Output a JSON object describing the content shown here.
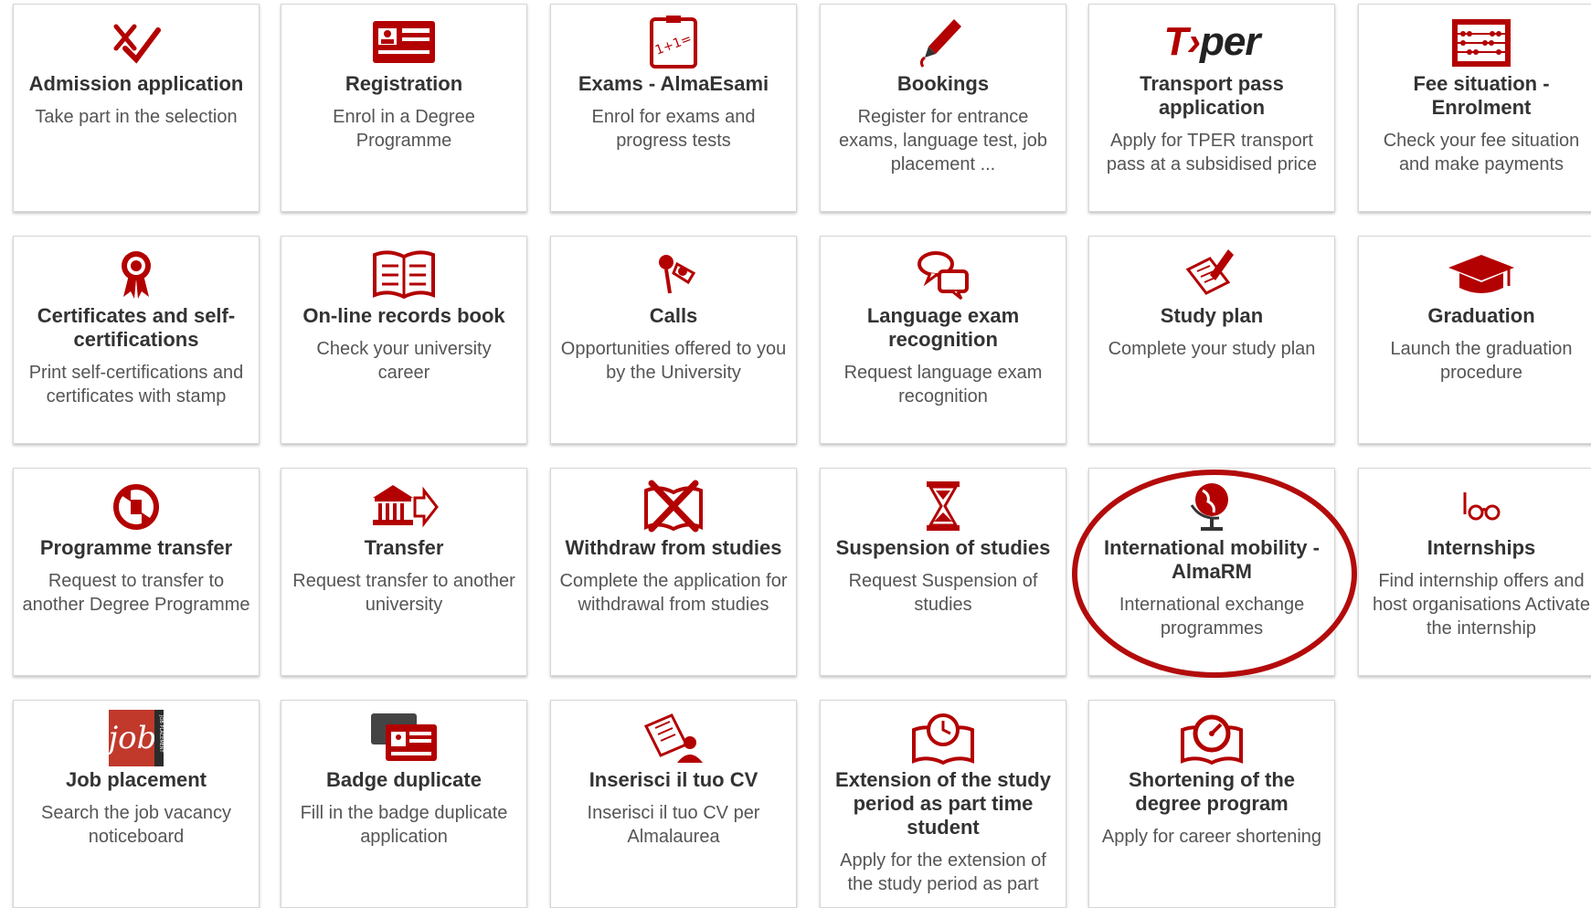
{
  "tiles": [
    {
      "id": "admission",
      "icon": "check-cross-icon",
      "title": "Admission application",
      "desc": "Take part in the selection"
    },
    {
      "id": "registration",
      "icon": "id-card-icon",
      "title": "Registration",
      "desc": "Enrol in a Degree Programme"
    },
    {
      "id": "exams",
      "icon": "calculator-board-icon",
      "title": "Exams - AlmaEsami",
      "desc": "Enrol for exams and progress tests"
    },
    {
      "id": "bookings",
      "icon": "pen-icon",
      "title": "Bookings",
      "desc": "Register for entrance exams, language test, job placement ..."
    },
    {
      "id": "transport",
      "icon": "tper-logo",
      "title": "Transport pass application",
      "desc": "Apply for TPER transport pass at a subsidised price"
    },
    {
      "id": "fee",
      "icon": "abacus-icon",
      "title": "Fee situation - Enrolment",
      "desc": "Check your fee situation and make payments"
    },
    {
      "id": "certificates",
      "icon": "rosette-icon",
      "title": "Certificates and self-certifications",
      "desc": "Print self-certifications and certificates with stamp"
    },
    {
      "id": "records",
      "icon": "open-book-icon",
      "title": "On-line records book",
      "desc": "Check your university career"
    },
    {
      "id": "calls",
      "icon": "pushpin-icon",
      "title": "Calls",
      "desc": "Opportunities offered to you by the University"
    },
    {
      "id": "language",
      "icon": "speech-bubbles-icon",
      "title": "Language exam recognition",
      "desc": "Request language exam recognition"
    },
    {
      "id": "studyplan",
      "icon": "document-pen-icon",
      "title": "Study plan",
      "desc": "Complete your study plan"
    },
    {
      "id": "graduation",
      "icon": "graduation-cap-icon",
      "title": "Graduation",
      "desc": "Launch the graduation procedure"
    },
    {
      "id": "progtransfer",
      "icon": "rotate-arrows-icon",
      "title": "Programme transfer",
      "desc": "Request to transfer to another Degree Programme"
    },
    {
      "id": "transfer",
      "icon": "building-arrow-icon",
      "title": "Transfer",
      "desc": "Request transfer to another university"
    },
    {
      "id": "withdraw",
      "icon": "book-cross-icon",
      "title": "Withdraw from studies",
      "desc": "Complete the application for withdrawal from studies"
    },
    {
      "id": "suspension",
      "icon": "hourglass-icon",
      "title": "Suspension of studies",
      "desc": "Request Suspension of studies"
    },
    {
      "id": "mobility",
      "icon": "globe-icon",
      "title": "International mobility - AlmaRM",
      "desc": "International exchange programmes"
    },
    {
      "id": "internships",
      "icon": "glasses-icon",
      "title": "Internships",
      "desc": "Find internship offers and host organisations Activate the internship"
    },
    {
      "id": "job",
      "icon": "job-placement-logo",
      "title": "Job placement",
      "desc": "Search the job vacancy noticeboard"
    },
    {
      "id": "badge",
      "icon": "badge-cards-icon",
      "title": "Badge duplicate",
      "desc": "Fill in the badge duplicate application"
    },
    {
      "id": "cv",
      "icon": "cv-document-icon",
      "title": "Inserisci il tuo CV",
      "desc": "Inserisci il tuo CV per Almalaurea"
    },
    {
      "id": "extension",
      "icon": "book-clock-icon",
      "title": "Extension of the study period as part time student",
      "desc": "Apply for the extension of the study period as part"
    },
    {
      "id": "shortening",
      "icon": "book-gauge-icon",
      "title": "Shortening of the degree program",
      "desc": "Apply for career shortening"
    }
  ],
  "tper_logo": {
    "t": "T",
    "arrow": "›",
    "per": "per"
  },
  "job_logo": {
    "text": "job",
    "side": "JOB PLACEMENT"
  },
  "colors": {
    "accent": "#b30000",
    "title": "#333333",
    "desc": "#555555",
    "highlight": "#b30b0b"
  }
}
